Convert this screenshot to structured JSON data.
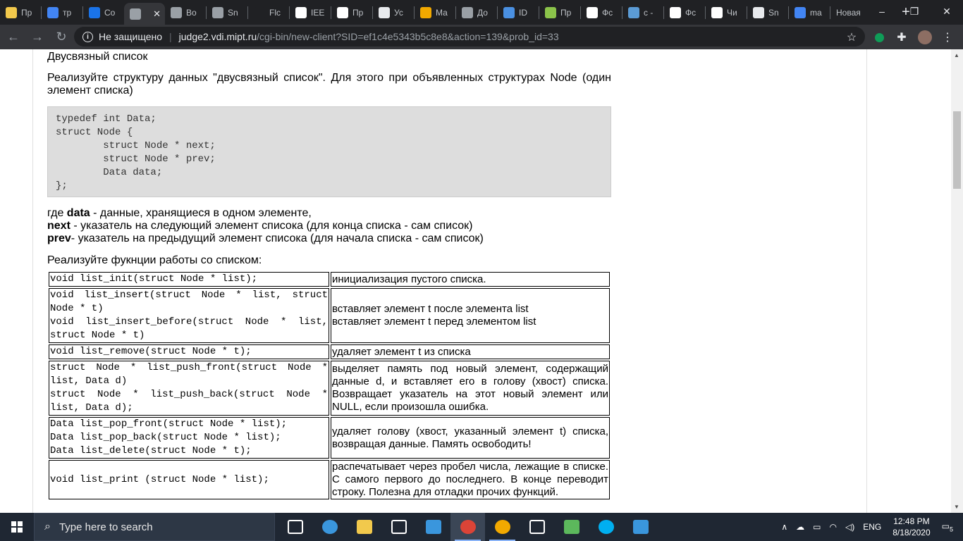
{
  "browser": {
    "tabs": [
      {
        "title": "Пр",
        "icon": "bookmark-icon",
        "color": "#f2c94c"
      },
      {
        "title": "тр",
        "icon": "google-icon",
        "color": "#4285f4"
      },
      {
        "title": "Co",
        "icon": "chat-icon",
        "color": "#1a73e8"
      },
      {
        "title": "",
        "icon": "globe-icon",
        "color": "#9aa0a6"
      },
      {
        "title": "Во",
        "icon": "globe-icon",
        "color": "#9aa0a6"
      },
      {
        "title": "Sn",
        "icon": "globe-icon",
        "color": "#9aa0a6"
      },
      {
        "title": "Flc",
        "icon": "fl-icon",
        "color": "#202124"
      },
      {
        "title": "IEE",
        "icon": "wikipedia-icon",
        "color": "#ffffff"
      },
      {
        "title": "Пр",
        "icon": "dp-icon",
        "color": "#ffffff"
      },
      {
        "title": "Ус",
        "icon": "globe-icon",
        "color": "#e8eaed"
      },
      {
        "title": "Ма",
        "icon": "m-icon",
        "color": "#f2a900"
      },
      {
        "title": "До",
        "icon": "globe-icon",
        "color": "#9aa0a6"
      },
      {
        "title": "ID",
        "icon": "id-icon",
        "color": "#4a90e2"
      },
      {
        "title": "Пр",
        "icon": "book-icon",
        "color": "#8bc34a"
      },
      {
        "title": "Фс",
        "icon": "doc-icon",
        "color": "#ffffff"
      },
      {
        "title": "с -",
        "icon": "stack-icon",
        "color": "#5b9bd5"
      },
      {
        "title": "Фс",
        "icon": "doc-icon",
        "color": "#ffffff"
      },
      {
        "title": "Чи",
        "icon": "wikipedia-icon",
        "color": "#ffffff"
      },
      {
        "title": "Sn",
        "icon": "globe-icon",
        "color": "#e8eaed"
      },
      {
        "title": "ma",
        "icon": "google-icon",
        "color": "#4285f4"
      },
      {
        "title": "Новая",
        "icon": "",
        "color": ""
      }
    ],
    "active_tab_index": 3,
    "new_tab_label": "+",
    "window_controls": {
      "minimize": "–",
      "maximize": "❐",
      "close": "✕"
    },
    "address": {
      "security": "Не защищено",
      "host": "judge2.vdi.mipt.ru",
      "path": "/cgi-bin/new-client?SID=ef1c4e5343b5c8e8&action=139&prob_id=33"
    }
  },
  "problem": {
    "title": "Двусвязный список",
    "intro": "Реализуйте структуру данных \"двусвязный список\". Для этого при объявленных структурах Node (один элемент списка)",
    "code": "typedef int Data;\nstruct Node {\n        struct Node * next;\n        struct Node * prev;\n        Data data;\n};",
    "fields": [
      {
        "name": "data",
        "desc": " - данные, хранящиеся в одном элементе,",
        "prefix": "где "
      },
      {
        "name": "next",
        "desc": " - указатель на следующий элемент списока (для конца списка - сам список)",
        "prefix": ""
      },
      {
        "name": "prev",
        "desc": "- указатель на предыдущий элемент списока (для начала списка - сам список)",
        "prefix": ""
      }
    ],
    "functions_heading": "Реализуйте фукнции работы со списком:",
    "functions": [
      {
        "sig": "void list_init(struct Node * list);",
        "desc": "инициализация пустого списка."
      },
      {
        "sig": "void list_insert(struct Node * list, struct Node * t)\nvoid list_insert_before(struct Node * list, struct Node * t)",
        "desc": "вставляет элемент t после элемента list\nвставляет элемент t перед элементом list"
      },
      {
        "sig": "void list_remove(struct Node * t);",
        "desc": "удаляет элемент t из списка"
      },
      {
        "sig": "struct Node * list_push_front(struct Node * list, Data d)\nstruct Node * list_push_back(struct Node * list, Data d);",
        "desc": "выделяет память под новый элемент, содержащий данные d, и вставляет его в голову (хвост) списка. Возвращает указатель на этот новый элемент или NULL, если произошла ошибка."
      },
      {
        "sig": "Data list_pop_front(struct Node * list);\nData list_pop_back(struct Node * list);\nData list_delete(struct Node * t);",
        "desc": "удаляет голову (хвост, указанный элемент t) списка, возвращая данные. Память освободить!"
      },
      {
        "sig": "void list_print (struct Node * list);",
        "desc": "распечатывает через пробел числа, лежащие в списке. С самого первого до последнего. В конце переводит строку. Полезна для отладки прочих функций."
      }
    ]
  },
  "taskbar": {
    "search_placeholder": "Type here to search",
    "apps": [
      "task-view-icon",
      "edge-icon",
      "file-explorer-icon",
      "store-icon",
      "mail-icon",
      "chrome-icon",
      "yandex-browser-icon",
      "settings-icon",
      "solitaire-icon",
      "skype-icon",
      "photos-icon"
    ],
    "language": "ENG",
    "time": "12:48 PM",
    "date": "8/18/2020",
    "notifications": "5"
  }
}
